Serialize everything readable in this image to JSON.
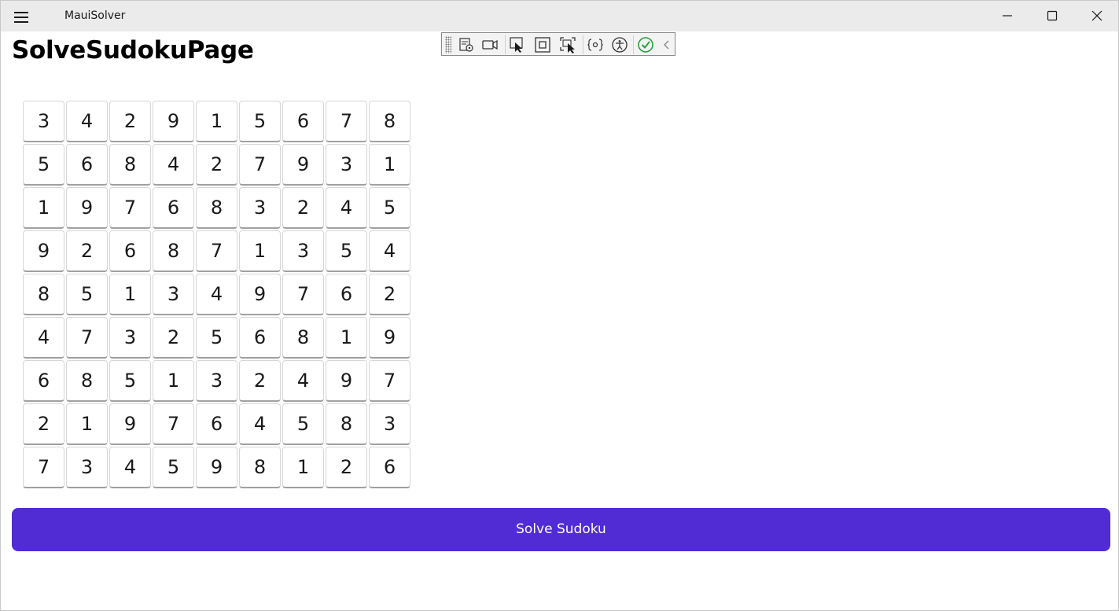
{
  "window": {
    "app_title": "MauiSolver"
  },
  "page": {
    "title": "SolveSudokuPage"
  },
  "debug_toolbar": {
    "items": [
      {
        "name": "go-to-live-visual-tree-icon"
      },
      {
        "name": "record-icon"
      },
      {
        "name": "select-element-icon"
      },
      {
        "name": "display-layout-adorners-icon"
      },
      {
        "name": "track-focused-element-icon"
      },
      {
        "name": "binding-failures-icon"
      },
      {
        "name": "accessibility-checker-icon"
      },
      {
        "name": "hot-reload-status-icon"
      },
      {
        "name": "collapse-toolbar-icon"
      }
    ],
    "status_color": "#22a33a"
  },
  "sudoku": {
    "rows": [
      [
        "3",
        "4",
        "2",
        "9",
        "1",
        "5",
        "6",
        "7",
        "8"
      ],
      [
        "5",
        "6",
        "8",
        "4",
        "2",
        "7",
        "9",
        "3",
        "1"
      ],
      [
        "1",
        "9",
        "7",
        "6",
        "8",
        "3",
        "2",
        "4",
        "5"
      ],
      [
        "9",
        "2",
        "6",
        "8",
        "7",
        "1",
        "3",
        "5",
        "4"
      ],
      [
        "8",
        "5",
        "1",
        "3",
        "4",
        "9",
        "7",
        "6",
        "2"
      ],
      [
        "4",
        "7",
        "3",
        "2",
        "5",
        "6",
        "8",
        "1",
        "9"
      ],
      [
        "6",
        "8",
        "5",
        "1",
        "3",
        "2",
        "4",
        "9",
        "7"
      ],
      [
        "2",
        "1",
        "9",
        "7",
        "6",
        "4",
        "5",
        "8",
        "3"
      ],
      [
        "7",
        "3",
        "4",
        "5",
        "9",
        "8",
        "1",
        "2",
        "6"
      ]
    ]
  },
  "actions": {
    "solve_label": "Solve Sudoku",
    "accent_color": "#512bd4"
  }
}
